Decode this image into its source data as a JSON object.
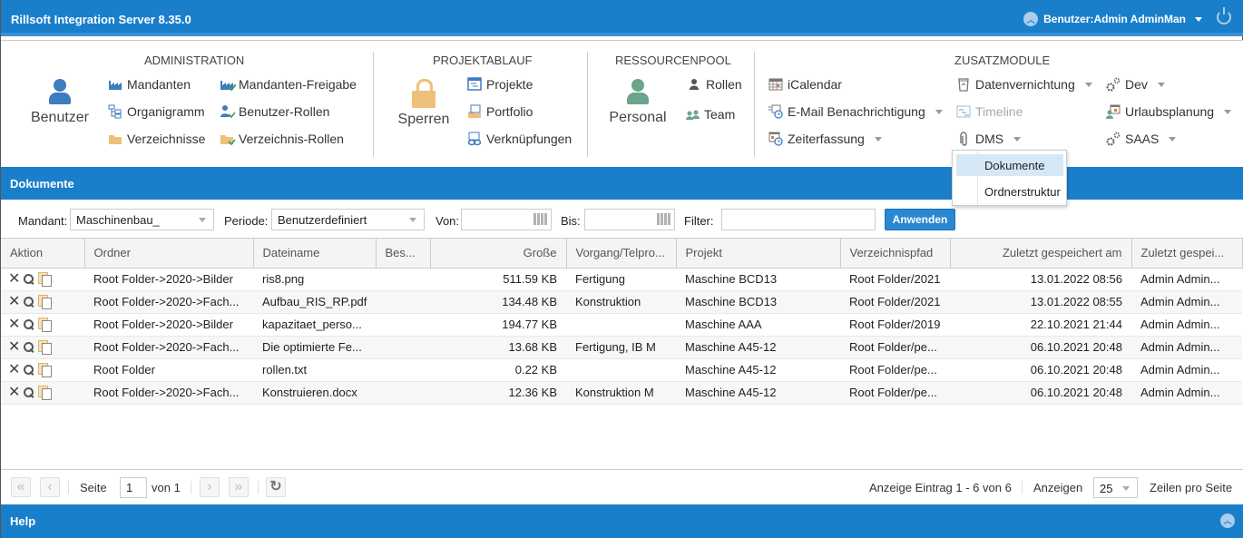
{
  "app": {
    "title": "Rillsoft Integration Server 8.35.0",
    "user_label": "Benutzer:Admin AdminMan"
  },
  "ribbon": {
    "administration": {
      "title": "ADMINISTRATION",
      "big_button": "Benutzer",
      "items": [
        "Mandanten",
        "Mandanten-Freigabe",
        "Organigramm",
        "Benutzer-Rollen",
        "Verzeichnisse",
        "Verzeichnis-Rollen"
      ]
    },
    "projektablauf": {
      "title": "PROJEKTABLAUF",
      "big_button": "Sperren",
      "items": [
        "Projekte",
        "Portfolio",
        "Verknüpfungen"
      ]
    },
    "ressourcenpool": {
      "title": "RESSOURCENPOOL",
      "big_button": "Personal",
      "items": [
        "Rollen",
        "Team"
      ]
    },
    "zusatzmodule": {
      "title": "ZUSATZMODULE",
      "items": [
        "iCalendar",
        "E-Mail Benachrichtigung",
        "Zeiterfassung",
        "Datenvernichtung",
        "Timeline",
        "DMS",
        "Dev",
        "Urlaubsplanung",
        "SAAS"
      ]
    }
  },
  "dms_menu": {
    "items": [
      "Dokumente",
      "Ordnerstruktur"
    ],
    "highlighted": "Dokumente"
  },
  "panel": {
    "title": "Dokumente"
  },
  "filters": {
    "mandant_label": "Mandant:",
    "mandant_value": "Maschinenbau_",
    "periode_label": "Periode:",
    "periode_value": "Benutzerdefiniert",
    "von_label": "Von:",
    "von_value": "",
    "bis_label": "Bis:",
    "bis_value": "",
    "filter_label": "Filter:",
    "filter_value": "",
    "apply_button": "Anwenden"
  },
  "table": {
    "columns": [
      "Aktion",
      "Ordner",
      "Dateiname",
      "Bes...",
      "Große",
      "Vorgang/Telpro...",
      "Projekt",
      "Verzeichnispfad",
      "Zuletzt gespeichert am",
      "Zuletzt gespei..."
    ],
    "rows": [
      {
        "ordner": "Root Folder->2020->Bilder",
        "dateiname": "ris8.png",
        "bes": "",
        "groesse": "511.59 KB",
        "vorgang": "Fertigung",
        "projekt": "Maschine BCD13",
        "pfad": "Root Folder/2021",
        "gespeichert_am": "13.01.2022 08:56",
        "gespeichert_von": "Admin Admin..."
      },
      {
        "ordner": "Root Folder->2020->Fach...",
        "dateiname": "Aufbau_RIS_RP.pdf",
        "bes": "",
        "groesse": "134.48 KB",
        "vorgang": "Konstruktion",
        "projekt": "Maschine BCD13",
        "pfad": "Root Folder/2021",
        "gespeichert_am": "13.01.2022 08:55",
        "gespeichert_von": "Admin Admin..."
      },
      {
        "ordner": "Root Folder->2020->Bilder",
        "dateiname": "kapazitaet_perso...",
        "bes": "",
        "groesse": "194.77 KB",
        "vorgang": "",
        "projekt": "Maschine AAA",
        "pfad": "Root Folder/2019",
        "gespeichert_am": "22.10.2021 21:44",
        "gespeichert_von": "Admin Admin..."
      },
      {
        "ordner": "Root Folder->2020->Fach...",
        "dateiname": "Die optimierte Fe...",
        "bes": "",
        "groesse": "13.68 KB",
        "vorgang": "Fertigung, IB M",
        "projekt": "Maschine A45-12",
        "pfad": "Root Folder/pe...",
        "gespeichert_am": "06.10.2021 20:48",
        "gespeichert_von": "Admin Admin..."
      },
      {
        "ordner": "Root Folder",
        "dateiname": "rollen.txt",
        "bes": "",
        "groesse": "0.22 KB",
        "vorgang": "",
        "projekt": "Maschine A45-12",
        "pfad": "Root Folder/pe...",
        "gespeichert_am": "06.10.2021 20:48",
        "gespeichert_von": "Admin Admin..."
      },
      {
        "ordner": "Root Folder->2020->Fach...",
        "dateiname": "Konstruieren.docx",
        "bes": "",
        "groesse": "12.36 KB",
        "vorgang": "Konstruktion M",
        "projekt": "Maschine A45-12",
        "pfad": "Root Folder/pe...",
        "gespeichert_am": "06.10.2021 20:48",
        "gespeichert_von": "Admin Admin..."
      }
    ],
    "row_actions": [
      "delete-icon",
      "search-icon",
      "preview-documents-icon"
    ]
  },
  "pager": {
    "seite_label": "Seite",
    "page_value": "1",
    "von_label": "von 1",
    "info": "Anzeige Eintrag 1 - 6 von 6",
    "anzeigen_label": "Anzeigen",
    "page_size": "25",
    "rows_per_page_label": "Zeilen pro Seite"
  },
  "footer": {
    "title": "Help"
  },
  "colors": {
    "brand_blue": "#1a7fcb",
    "menu_highlight": "#d6e8f6"
  }
}
